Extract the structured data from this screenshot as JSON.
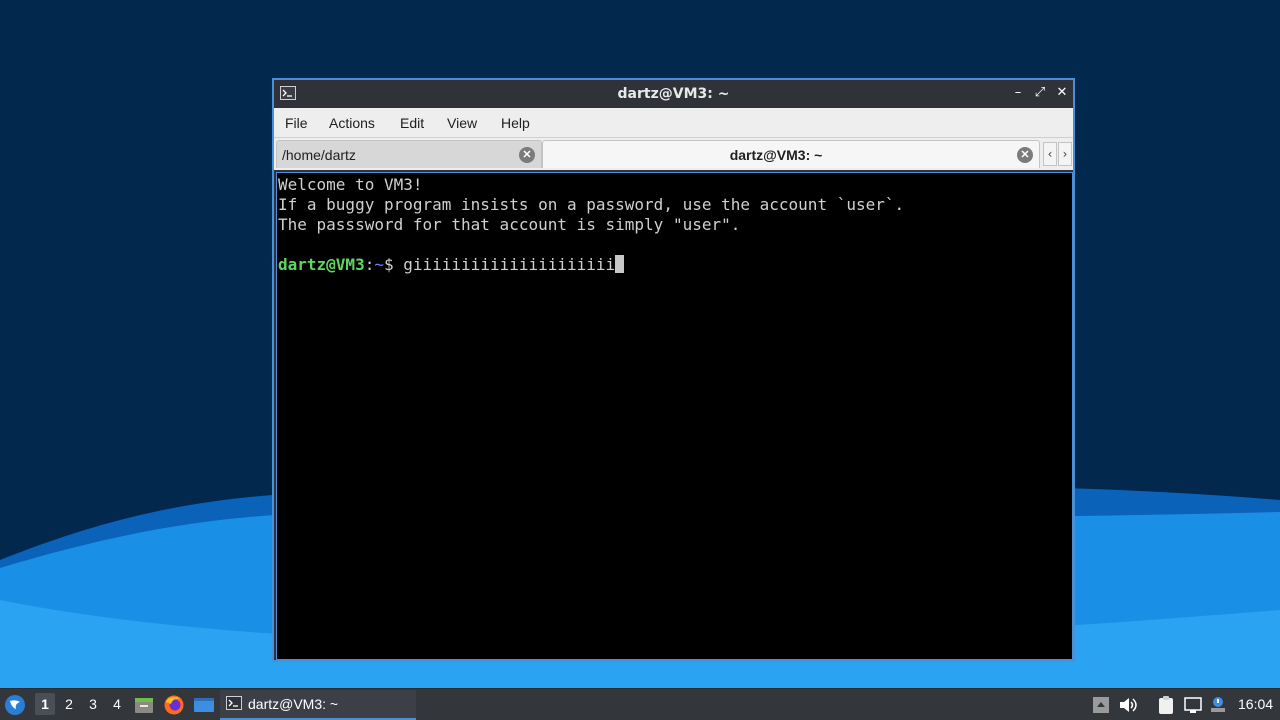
{
  "window": {
    "title": "dartz@VM3: ~",
    "buttons": {
      "minimize": "–",
      "maximize": "⤢",
      "close": "✕"
    }
  },
  "menu": [
    "File",
    "Actions",
    "Edit",
    "View",
    "Help"
  ],
  "tabs": [
    {
      "label": "/home/dartz",
      "active": false
    },
    {
      "label": "dartz@VM3: ~",
      "active": true
    }
  ],
  "tab_scroll": {
    "left": "‹",
    "right": "›"
  },
  "terminal": {
    "lines": [
      "Welcome to VM3!",
      "If a buggy program insists on a password, use the account `user`.",
      "The passsword for that account is simply \"user\"."
    ],
    "prompt_user": "dartz@VM3",
    "prompt_sep": ":",
    "prompt_path": "~",
    "prompt_symbol": "$ ",
    "command": "giiiiiiiiiiiiiiiiiiiii"
  },
  "taskbar": {
    "workspaces": [
      "1",
      "2",
      "3",
      "4"
    ],
    "active_workspace": "1",
    "task_label": "dartz@VM3: ~",
    "clock": "16:04"
  },
  "colors": {
    "desktop_dark": "#03284d",
    "desktop_wave": "#1a8fe6",
    "window_border": "#4a90d9",
    "prompt_green": "#5fd75f",
    "prompt_blue": "#5f87ff"
  }
}
